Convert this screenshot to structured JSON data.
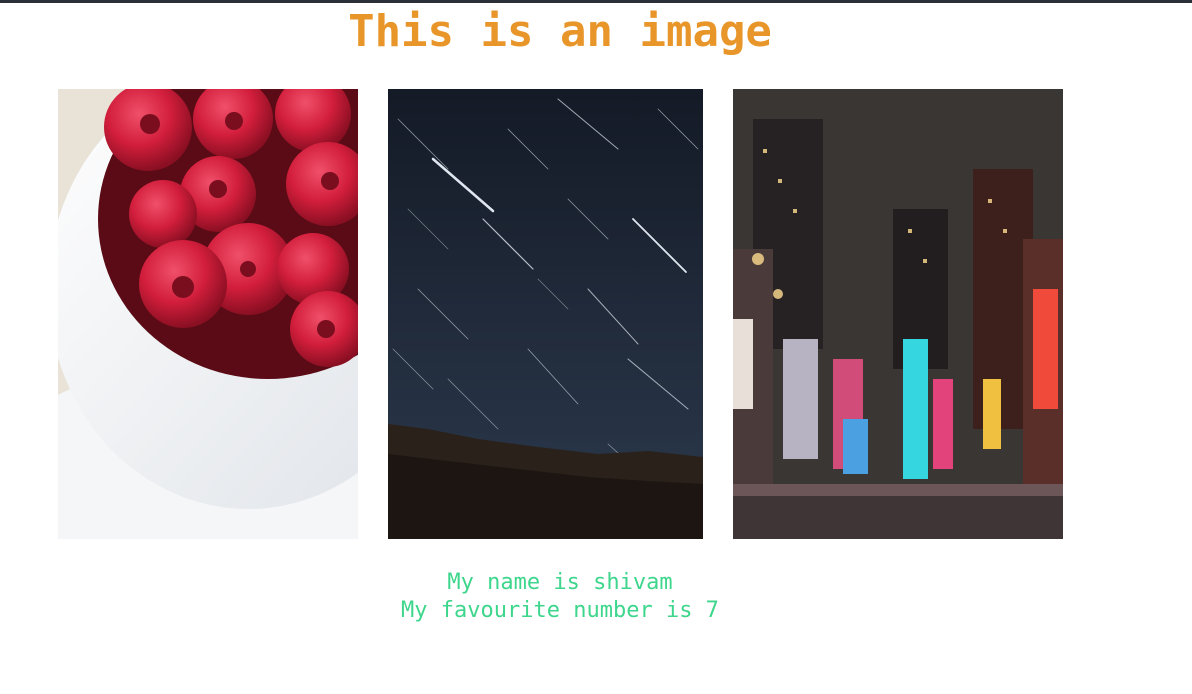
{
  "page": {
    "heading": "This is an image",
    "images": [
      {
        "icon": "raspberries-photo"
      },
      {
        "icon": "star-trails-photo"
      },
      {
        "icon": "city-night-photo"
      }
    ],
    "caption_lines": [
      "My name is shivam",
      "My favourite number is 7"
    ]
  },
  "colors": {
    "heading": "#e8962a",
    "caption": "#3dd68c",
    "top_bar": "#2b2f38"
  }
}
